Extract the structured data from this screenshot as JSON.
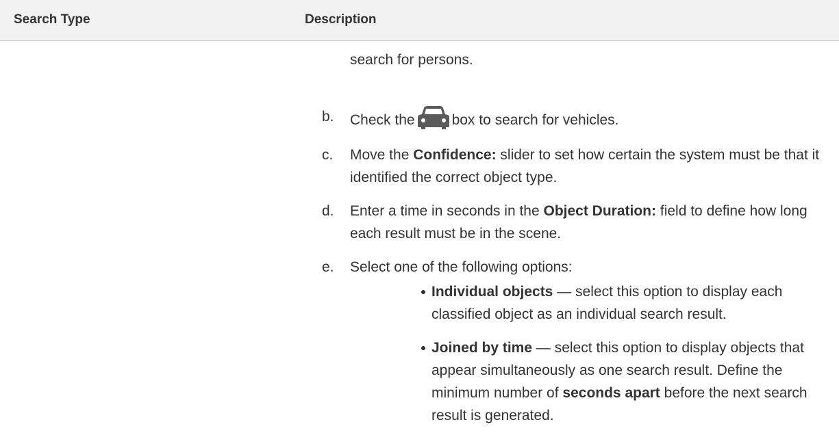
{
  "header": {
    "col_search_type": "Search Type",
    "col_description": "Description"
  },
  "description": {
    "intro_continuation": "search for persons.",
    "steps": [
      {
        "letter": "b.",
        "before_icon": "Check the",
        "icon": "car-icon",
        "after_icon": "box to search for vehicles."
      },
      {
        "letter": "c.",
        "pre": "Move the",
        "bold": "Confidence:",
        "post": "slider to set how certain the system must be that it identified the correct object type."
      },
      {
        "letter": "d.",
        "pre": "Enter a time in seconds in the",
        "bold": "Object Duration:",
        "post": "field to define how long each result must be in the scene."
      },
      {
        "letter": "e.",
        "text": "Select one of the following options:"
      }
    ],
    "options": [
      {
        "bold": "Individual objects",
        "text": "— select this option to display each classified object as an individual search result."
      },
      {
        "bold": "Joined by time",
        "text": "— select this option to display objects that appear simultaneously as one search result. Define the minimum number of",
        "bold2": "seconds apart",
        "text2": "before the next search result is generated."
      }
    ]
  },
  "colors": {
    "header_bg": "#f2f2f2",
    "text": "#333333",
    "icon": "#5a5a5a"
  }
}
